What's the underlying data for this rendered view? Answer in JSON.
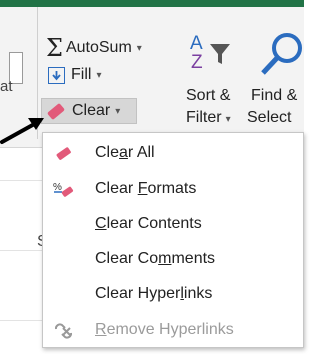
{
  "ribbon": {
    "autosum_label": "AutoSum",
    "fill_label": "Fill",
    "clear_label": "Clear",
    "sort_label_line1": "Sort &",
    "sort_label_line2": "Filter",
    "find_label_line1": "Find &",
    "find_label_line2": "Select",
    "left_fragment": "at",
    "caret": "▾",
    "accent_color": "#217346"
  },
  "sheet": {
    "column_fragment": "S"
  },
  "clear_menu": {
    "items": [
      {
        "pre": "Cle",
        "key": "a",
        "post": "r All",
        "icon": "eraser-icon",
        "enabled": true
      },
      {
        "pre": "Clear ",
        "key": "F",
        "post": "ormats",
        "icon": "clear-formats-icon",
        "enabled": true
      },
      {
        "pre": "",
        "key": "C",
        "post": "lear Contents",
        "icon": "",
        "enabled": true
      },
      {
        "pre": "Clear Co",
        "key": "m",
        "post": "ments",
        "icon": "",
        "enabled": true
      },
      {
        "pre": "Clear Hyper",
        "key": "l",
        "post": "inks",
        "icon": "",
        "enabled": true
      },
      {
        "pre": "",
        "key": "R",
        "post": "emove Hyperlinks",
        "icon": "remove-hyperlinks-icon",
        "enabled": false
      }
    ]
  }
}
